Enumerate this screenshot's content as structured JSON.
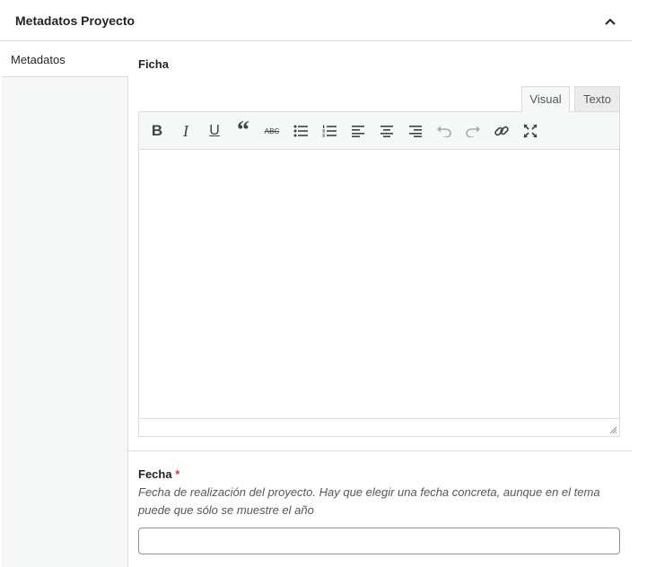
{
  "metabox": {
    "title": "Metadatos Proyecto",
    "toggle_icon": "chevron-up-icon"
  },
  "sidebar": {
    "tabs": [
      {
        "label": "Metadatos",
        "active": true
      }
    ]
  },
  "ficha": {
    "label": "Ficha",
    "modes": {
      "visual": "Visual",
      "text": "Texto",
      "active": "Visual"
    },
    "toolbar": [
      "bold-icon",
      "italic-icon",
      "underline-icon",
      "blockquote-icon",
      "strikethrough-icon",
      "bullet-list-icon",
      "numbered-list-icon",
      "align-left-icon",
      "align-center-icon",
      "align-right-icon",
      "undo-icon",
      "redo-icon",
      "link-icon",
      "fullscreen-icon"
    ],
    "content": ""
  },
  "fecha": {
    "label": "Fecha",
    "required_mark": "*",
    "description": "Fecha de realización del proyecto. Hay que elegir una fecha concreta, aunque en el tema puede que sólo se muestre el año",
    "value": ""
  },
  "colors": {
    "border": "#dcdcde",
    "required": "#d63638",
    "text": "#1d2327",
    "muted": "#50575e"
  }
}
